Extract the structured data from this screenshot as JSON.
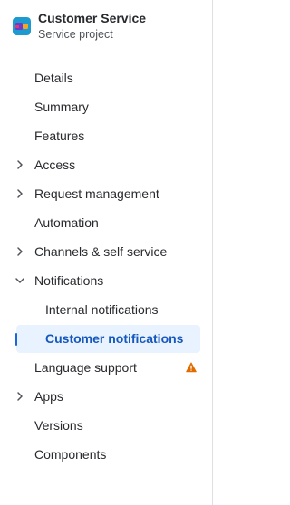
{
  "project": {
    "name": "Customer Service",
    "type": "Service project"
  },
  "nav": {
    "details": "Details",
    "summary": "Summary",
    "features": "Features",
    "access": "Access",
    "request_management": "Request management",
    "automation": "Automation",
    "channels": "Channels & self service",
    "notifications": "Notifications",
    "internal_notifications": "Internal notifications",
    "customer_notifications": "Customer notifications",
    "language_support": "Language support",
    "apps": "Apps",
    "versions": "Versions",
    "components": "Components"
  },
  "icons": {
    "collapsed": "chevron-right-icon",
    "expanded": "chevron-down-icon",
    "warning": "warning-icon"
  },
  "colors": {
    "selected_bg": "#e9f2ff",
    "selected_text": "#1558bc",
    "warning": "#e06c00"
  }
}
